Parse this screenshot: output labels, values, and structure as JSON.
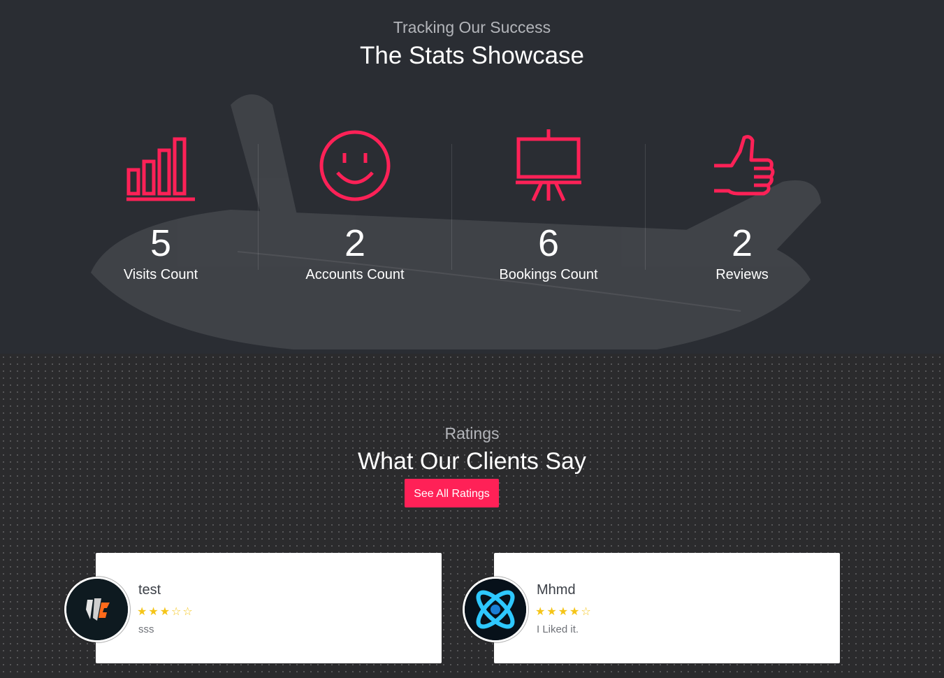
{
  "stats_section": {
    "eyebrow": "Tracking Our Success",
    "title": "The Stats Showcase",
    "accent_color": "#ff2157",
    "items": [
      {
        "icon": "bar-chart-icon",
        "value": "5",
        "label": "Visits Count"
      },
      {
        "icon": "smiley-icon",
        "value": "2",
        "label": "Accounts Count"
      },
      {
        "icon": "presentation-board-icon",
        "value": "6",
        "label": "Bookings Count"
      },
      {
        "icon": "thumbs-up-icon",
        "value": "2",
        "label": "Reviews"
      }
    ]
  },
  "ratings_section": {
    "eyebrow": "Ratings",
    "title": "What Our Clients Say",
    "button_label": "See All Ratings",
    "button_color": "#ff2157",
    "star_color": "#f5c518",
    "reviews": [
      {
        "name": "test",
        "rating": 3,
        "max_rating": 5,
        "stars_display": "★★★☆☆",
        "comment": "sss",
        "avatar_icon": "gaming-logo-avatar"
      },
      {
        "name": "Mhmd",
        "rating": 4,
        "max_rating": 5,
        "stars_display": "★★★★☆",
        "comment": "I Liked it.",
        "avatar_icon": "atom-logo-avatar"
      }
    ]
  }
}
